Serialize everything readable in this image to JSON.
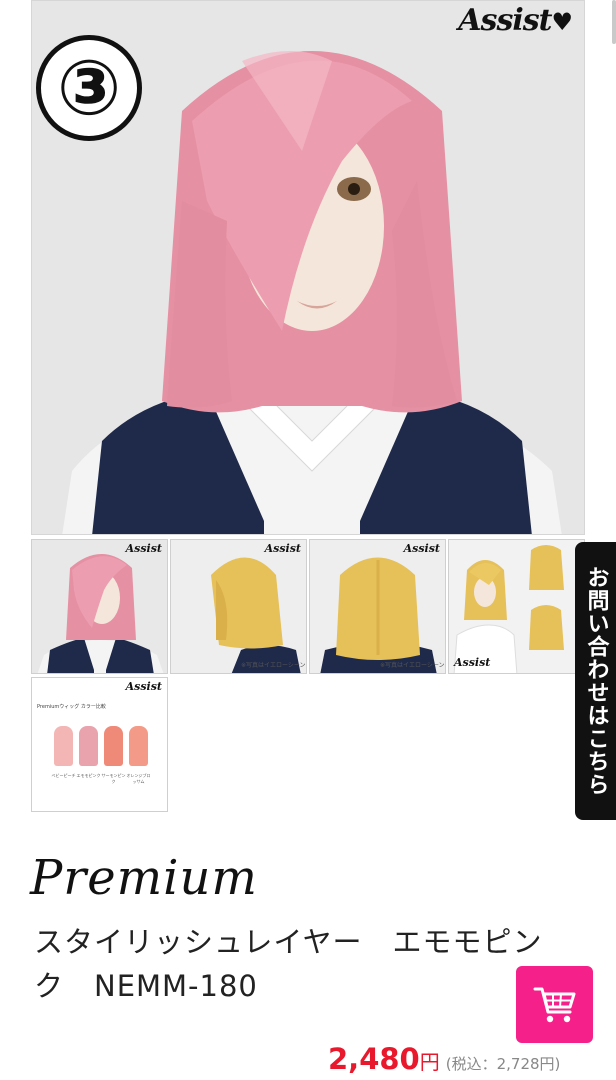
{
  "main_image": {
    "badge": "③",
    "logo": "Assist",
    "hair_color": "#e89aab",
    "alt": "pink layered wig on mannequin"
  },
  "thumbnails": [
    {
      "name": "thumb-pink-front",
      "logo": "Assist",
      "hair_color": "#e89aab"
    },
    {
      "name": "thumb-yellow-side",
      "logo": "Assist",
      "hair_color": "#e6c15a",
      "note": "※写真はイエローシーンです。"
    },
    {
      "name": "thumb-yellow-back",
      "logo": "Assist",
      "hair_color": "#e6c15a",
      "note": "※写真はイエローシーンです。"
    },
    {
      "name": "thumb-yellow-model",
      "logo": "Assist",
      "hair_color": "#e6c15a"
    }
  ],
  "swatch_card": {
    "logo": "Assist",
    "title": "Premiumウィッグ カラー比較",
    "swatches": [
      {
        "color": "#f4b6b4",
        "label": "ベビーピーチ"
      },
      {
        "color": "#e9a3ad",
        "label": "エモモピンク"
      },
      {
        "color": "#f08a78",
        "label": "サーモンピンク"
      },
      {
        "color": "#f49a88",
        "label": "オレンジブロッサム"
      }
    ]
  },
  "contact_tab": {
    "label": "お問い合わせはこちら"
  },
  "product": {
    "series": "Premium",
    "title": "スタイリッシュレイヤー　エモモピンク　NEMM-180",
    "price": "2,480",
    "yen": "円",
    "tax_note": "(税込：2,728円)"
  },
  "cart_button": {
    "icon": "cart-icon",
    "color": "#f5208a"
  }
}
